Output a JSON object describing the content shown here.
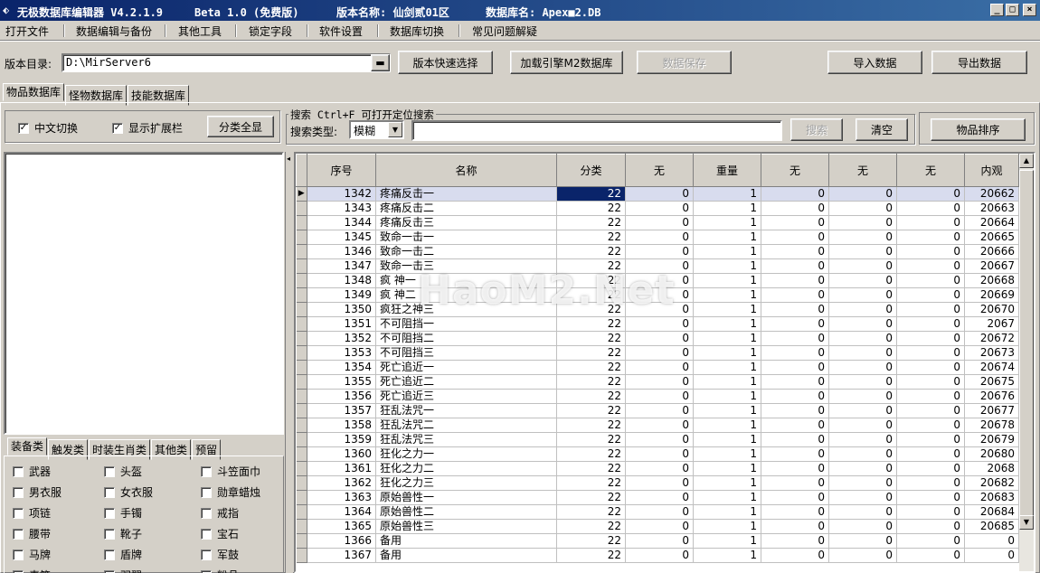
{
  "window": {
    "title_app": "无极数据库编辑器 V4.2.1.9",
    "title_beta": "Beta 1.0 (免费版)",
    "title_version": "版本名称: 仙剑贰01区",
    "title_db": "数据库名: Apex■2.DB",
    "min": "_",
    "max": "□",
    "close": "×"
  },
  "menu": [
    "打开文件",
    "数据编辑与备份",
    "其他工具",
    "锁定字段",
    "软件设置",
    "数据库切换",
    "常见问题解疑"
  ],
  "toolbar": {
    "dir_label": "版本目录:",
    "dir_value": "D:\\MirServer6",
    "quick_select": "版本快速选择",
    "load_engine": "加载引擎M2数据库",
    "save_data": "数据保存",
    "import_data": "导入数据",
    "export_data": "导出数据"
  },
  "tabs": [
    "物品数据库",
    "怪物数据库",
    "技能数据库"
  ],
  "options": {
    "chinese_switch": "中文切换",
    "show_ext": "显示扩展栏",
    "category_all": "分类全显"
  },
  "search": {
    "group_title": "搜索  Ctrl+F 可打开定位搜索",
    "type_label": "搜索类型:",
    "type_value": "模糊",
    "query": "",
    "search_btn": "搜索",
    "clear_btn": "清空",
    "sort_btn": "物品排序"
  },
  "category_tabs": [
    "装备类",
    "触发类",
    "时装生肖类",
    "其他类",
    "预留"
  ],
  "categories": [
    [
      "武器",
      "头盔",
      "斗笠面巾"
    ],
    [
      "男衣服",
      "女衣服",
      "勋章蜡烛"
    ],
    [
      "项链",
      "手镯",
      "戒指"
    ],
    [
      "腰带",
      "靴子",
      "宝石"
    ],
    [
      "马牌",
      "盾牌",
      "军鼓"
    ],
    [
      "毒符",
      "羽翼",
      "粉品"
    ]
  ],
  "grid": {
    "headers": [
      "序号",
      "名称",
      "分类",
      "无",
      "重量",
      "无",
      "无",
      "无",
      "内观"
    ],
    "rows": [
      [
        "1342",
        "疼痛反击一",
        "22",
        "0",
        "1",
        "0",
        "0",
        "0",
        "20662"
      ],
      [
        "1343",
        "疼痛反击二",
        "22",
        "0",
        "1",
        "0",
        "0",
        "0",
        "20663"
      ],
      [
        "1344",
        "疼痛反击三",
        "22",
        "0",
        "1",
        "0",
        "0",
        "0",
        "20664"
      ],
      [
        "1345",
        "致命一击一",
        "22",
        "0",
        "1",
        "0",
        "0",
        "0",
        "20665"
      ],
      [
        "1346",
        "致命一击二",
        "22",
        "0",
        "1",
        "0",
        "0",
        "0",
        "20666"
      ],
      [
        "1347",
        "致命一击三",
        "22",
        "0",
        "1",
        "0",
        "0",
        "0",
        "20667"
      ],
      [
        "1348",
        "疯    神一",
        "22",
        "0",
        "1",
        "0",
        "0",
        "0",
        "20668"
      ],
      [
        "1349",
        "疯    神二",
        "22",
        "0",
        "1",
        "0",
        "0",
        "0",
        "20669"
      ],
      [
        "1350",
        "疯狂之神三",
        "22",
        "0",
        "1",
        "0",
        "0",
        "0",
        "20670"
      ],
      [
        "1351",
        "不可阻挡一",
        "22",
        "0",
        "1",
        "0",
        "0",
        "0",
        "2067"
      ],
      [
        "1352",
        "不可阻挡二",
        "22",
        "0",
        "1",
        "0",
        "0",
        "0",
        "20672"
      ],
      [
        "1353",
        "不可阻挡三",
        "22",
        "0",
        "1",
        "0",
        "0",
        "0",
        "20673"
      ],
      [
        "1354",
        "死亡追近一",
        "22",
        "0",
        "1",
        "0",
        "0",
        "0",
        "20674"
      ],
      [
        "1355",
        "死亡追近二",
        "22",
        "0",
        "1",
        "0",
        "0",
        "0",
        "20675"
      ],
      [
        "1356",
        "死亡追近三",
        "22",
        "0",
        "1",
        "0",
        "0",
        "0",
        "20676"
      ],
      [
        "1357",
        "狂乱法咒一",
        "22",
        "0",
        "1",
        "0",
        "0",
        "0",
        "20677"
      ],
      [
        "1358",
        "狂乱法咒二",
        "22",
        "0",
        "1",
        "0",
        "0",
        "0",
        "20678"
      ],
      [
        "1359",
        "狂乱法咒三",
        "22",
        "0",
        "1",
        "0",
        "0",
        "0",
        "20679"
      ],
      [
        "1360",
        "狂化之力一",
        "22",
        "0",
        "1",
        "0",
        "0",
        "0",
        "20680"
      ],
      [
        "1361",
        "狂化之力二",
        "22",
        "0",
        "1",
        "0",
        "0",
        "0",
        "2068"
      ],
      [
        "1362",
        "狂化之力三",
        "22",
        "0",
        "1",
        "0",
        "0",
        "0",
        "20682"
      ],
      [
        "1363",
        "原始兽性一",
        "22",
        "0",
        "1",
        "0",
        "0",
        "0",
        "20683"
      ],
      [
        "1364",
        "原始兽性二",
        "22",
        "0",
        "1",
        "0",
        "0",
        "0",
        "20684"
      ],
      [
        "1365",
        "原始兽性三",
        "22",
        "0",
        "1",
        "0",
        "0",
        "0",
        "20685"
      ],
      [
        "1366",
        "备用",
        "22",
        "0",
        "1",
        "0",
        "0",
        "0",
        "0"
      ],
      [
        "1367",
        "备用",
        "22",
        "0",
        "1",
        "0",
        "0",
        "0",
        "0"
      ]
    ]
  },
  "watermark": "HaoM2.Net",
  "colors": {
    "title_start": "#0a246a",
    "title_end": "#3a6ea5",
    "selection": "#0a246a",
    "current_row": "#d8dcee"
  }
}
